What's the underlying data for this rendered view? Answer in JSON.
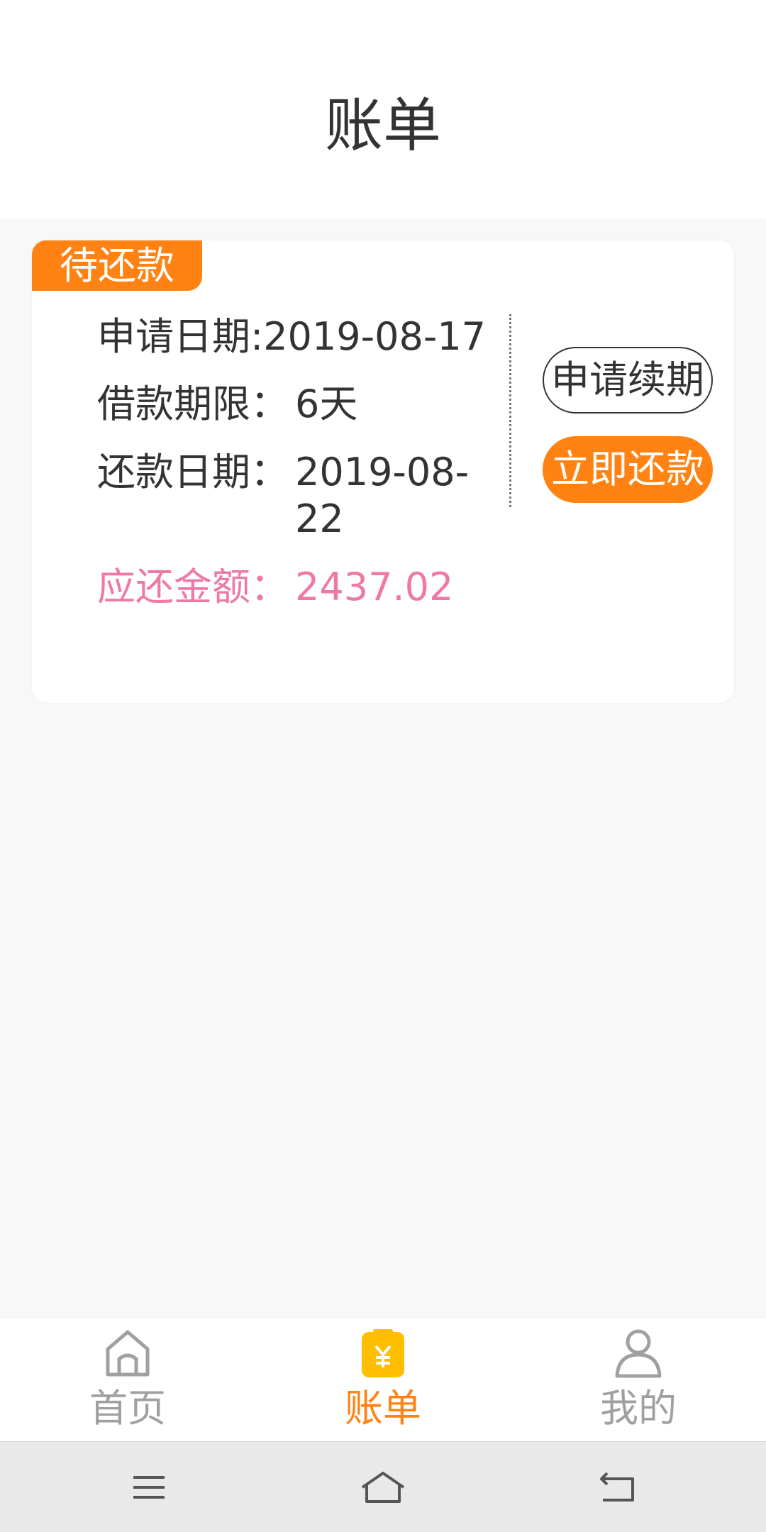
{
  "header": {
    "title": "账单"
  },
  "bill": {
    "status": "待还款",
    "apply_date_label": "申请日期:",
    "apply_date": "2019-08-17",
    "term_label": "借款期限：",
    "term_value": "6天",
    "repay_date_label": "还款日期：",
    "repay_date_line1": "2019-08-",
    "repay_date_line2": "22",
    "amount_label": "应还金额：",
    "amount_value": "2437.02",
    "renew_button": "申请续期",
    "pay_button": "立即还款"
  },
  "tabs": [
    {
      "label": "首页",
      "icon": "home-icon",
      "active": false
    },
    {
      "label": "账单",
      "icon": "bill-icon",
      "active": true
    },
    {
      "label": "我的",
      "icon": "profile-icon",
      "active": false
    }
  ],
  "navbar": {
    "icons": [
      "menu-icon",
      "home-nav-icon",
      "back-icon"
    ]
  },
  "colors": {
    "accent": "#ff8212",
    "amount": "#ee79a6",
    "inactive": "#a0a0a0"
  }
}
